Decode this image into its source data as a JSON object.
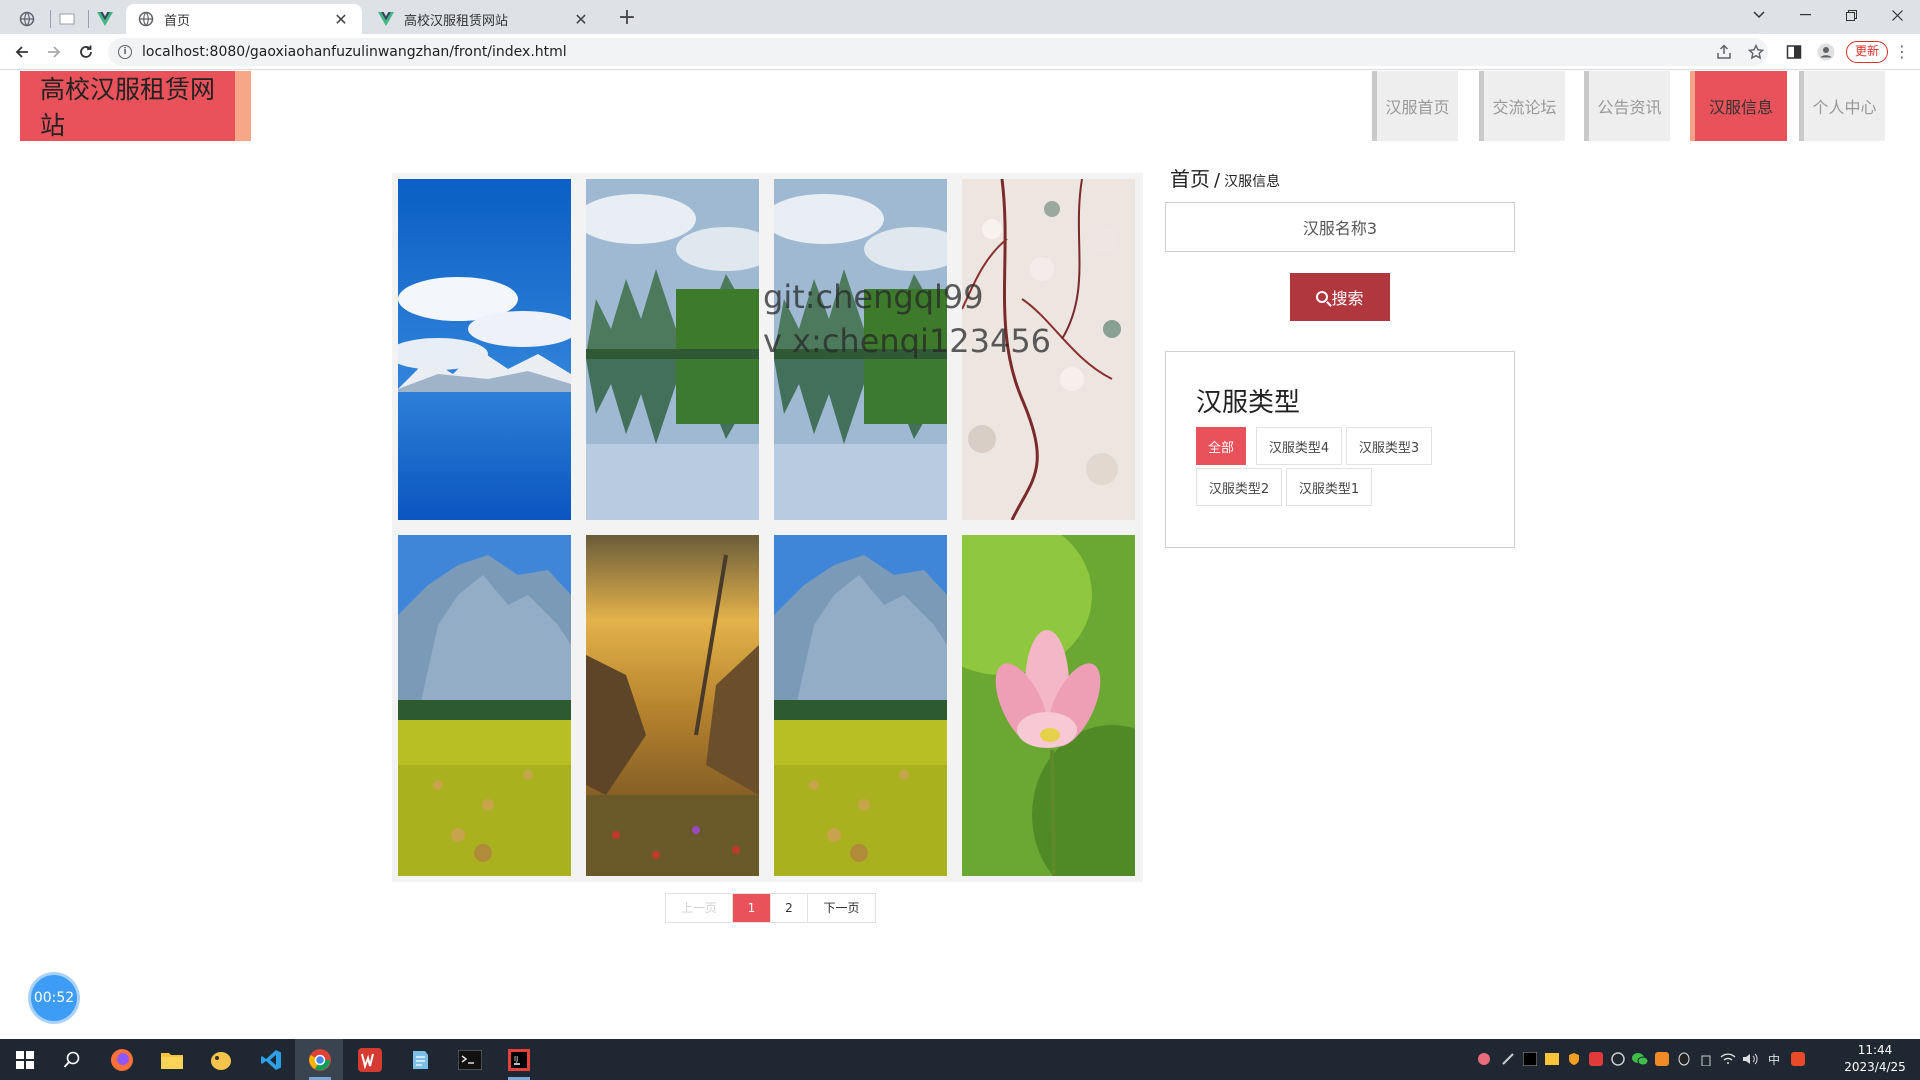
{
  "browser": {
    "tabs": [
      {
        "title": "首页",
        "active": true
      },
      {
        "title": "高校汉服租赁网站",
        "active": false
      }
    ],
    "new_tab_icon": "plus-icon",
    "url": "localhost:8080/gaoxiaohanfuzulinwangzhan/front/index.html",
    "update_label": "更新"
  },
  "site": {
    "logo": "高校汉服租赁网站",
    "nav": [
      {
        "label": "汉服首页",
        "active": false
      },
      {
        "label": "交流论坛",
        "active": false
      },
      {
        "label": "公告资讯",
        "active": false
      },
      {
        "label": "汉服信息",
        "active": true
      },
      {
        "label": "个人中心",
        "active": false
      }
    ],
    "accent": "#e9525a",
    "accent_light": "#f7a688",
    "button_dark": "#b1373f"
  },
  "breadcrumb": {
    "home": "首页",
    "separator": "/",
    "current": "汉服信息"
  },
  "search": {
    "placeholder": "汉服名称3",
    "button_label": "搜索"
  },
  "types": {
    "title": "汉服类型",
    "items": [
      {
        "label": "全部",
        "active": true
      },
      {
        "label": "汉服类型4",
        "active": false
      },
      {
        "label": "汉服类型3",
        "active": false
      },
      {
        "label": "汉服类型2",
        "active": false
      },
      {
        "label": "汉服类型1",
        "active": false
      }
    ]
  },
  "gallery": {
    "items": [
      {
        "scene": "blue-lake-snow-mountain"
      },
      {
        "scene": "karst-mountain-reflection"
      },
      {
        "scene": "karst-mountain-reflection"
      },
      {
        "scene": "cherry-blossom-branches"
      },
      {
        "scene": "mountain-hay-field"
      },
      {
        "scene": "sunset-valley-flowers"
      },
      {
        "scene": "mountain-hay-field"
      },
      {
        "scene": "pink-lotus-flower"
      }
    ]
  },
  "watermark": {
    "line1": "git:chengql99",
    "line2": "v x:chenqi123456"
  },
  "pager": {
    "prev": "上一页",
    "pages": [
      "1",
      "2"
    ],
    "current": "1",
    "next": "下一页"
  },
  "timer": "00:52",
  "taskbar": {
    "time": "11:44",
    "date": "2023/4/25",
    "ime": "中"
  }
}
